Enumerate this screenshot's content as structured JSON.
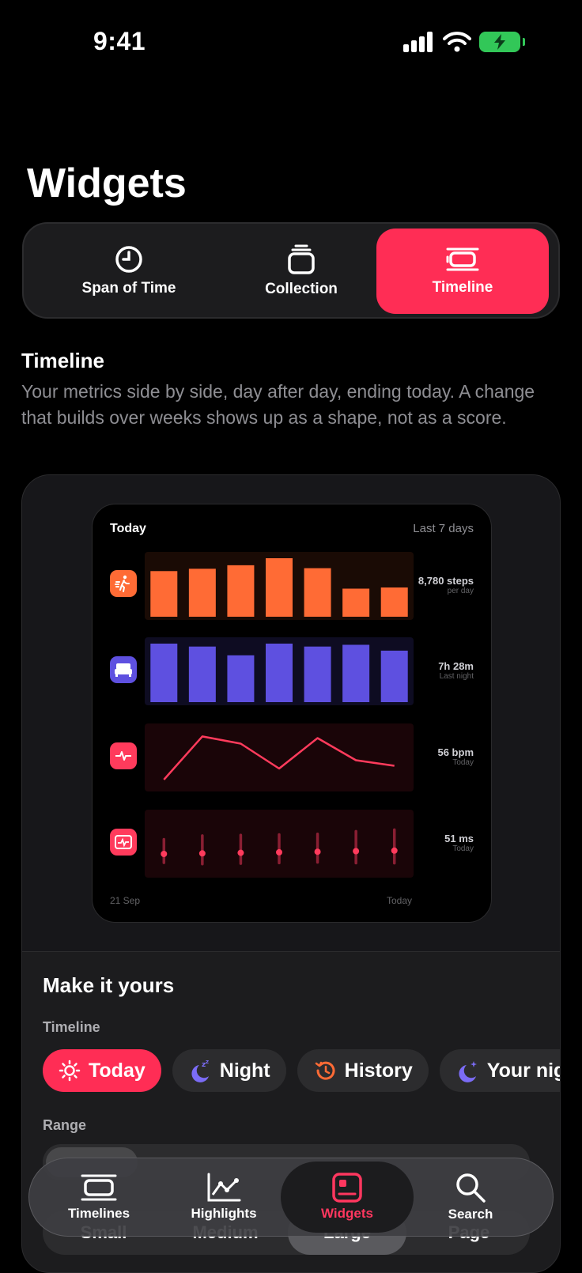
{
  "status": {
    "time": "9:41"
  },
  "page_title": "Widgets",
  "segments": [
    {
      "label": "Span of Time",
      "icon": "clock-icon",
      "active": false
    },
    {
      "label": "Collection",
      "icon": "stack-icon",
      "active": false
    },
    {
      "label": "Timeline",
      "icon": "timeline-icon",
      "active": true
    }
  ],
  "section": {
    "title": "Timeline",
    "description": "Your metrics side by side, day after day, ending today. A change that builds over weeks shows up as a shape, not as a score."
  },
  "widget": {
    "title": "Today",
    "range": "Last 7 days",
    "start_label": "21 Sep",
    "end_label": "Today",
    "metrics": [
      {
        "icon": "walking-icon",
        "color": "#ff6b35",
        "type": "bar",
        "values": [
          0.78,
          0.82,
          0.88,
          1.0,
          0.83,
          0.48,
          0.5
        ],
        "value": "8,780 steps",
        "sub": "per day"
      },
      {
        "icon": "bed-icon",
        "color": "#5e50e0",
        "type": "bar",
        "values": [
          1.0,
          0.95,
          0.8,
          1.0,
          0.95,
          0.98,
          0.88
        ],
        "value": "7h 28m",
        "sub": "Last night"
      },
      {
        "icon": "heart-rate-icon",
        "color": "#ff3b5c",
        "type": "line",
        "values": [
          0.1,
          0.88,
          0.75,
          0.3,
          0.85,
          0.45,
          0.35
        ],
        "value": "56 bpm",
        "sub": "Today"
      },
      {
        "icon": "hrv-icon",
        "color": "#ff3b5c",
        "type": "range",
        "values": [
          0.28,
          0.34,
          0.34,
          0.34,
          0.34,
          0.38,
          0.4
        ],
        "value": "51 ms",
        "sub": "Today"
      }
    ]
  },
  "customize": {
    "title": "Make it yours",
    "timeline_label": "Timeline",
    "chips": [
      {
        "label": "Today",
        "icon": "sun-icon",
        "active": true
      },
      {
        "label": "Night",
        "icon": "moon-zzz-icon",
        "active": false
      },
      {
        "label": "History",
        "icon": "history-icon",
        "active": false
      },
      {
        "label": "Your nig",
        "icon": "moon-star-icon",
        "active": false
      }
    ],
    "range_label": "Range",
    "sizes": [
      {
        "label": "Small",
        "active": false
      },
      {
        "label": "Medium",
        "active": false
      },
      {
        "label": "Large",
        "active": true
      },
      {
        "label": "Page",
        "active": false
      }
    ]
  },
  "tabs": [
    {
      "label": "Timelines",
      "icon": "timelines-icon",
      "active": false
    },
    {
      "label": "Highlights",
      "icon": "chart-line-icon",
      "active": false
    },
    {
      "label": "Widgets",
      "icon": "widget-icon",
      "active": true
    },
    {
      "label": "Search",
      "icon": "search-icon",
      "active": false
    }
  ],
  "colors": {
    "accent": "#ff2d55",
    "steps": "#ff6b35",
    "sleep": "#5e50e0",
    "heart": "#ff3b5c"
  }
}
